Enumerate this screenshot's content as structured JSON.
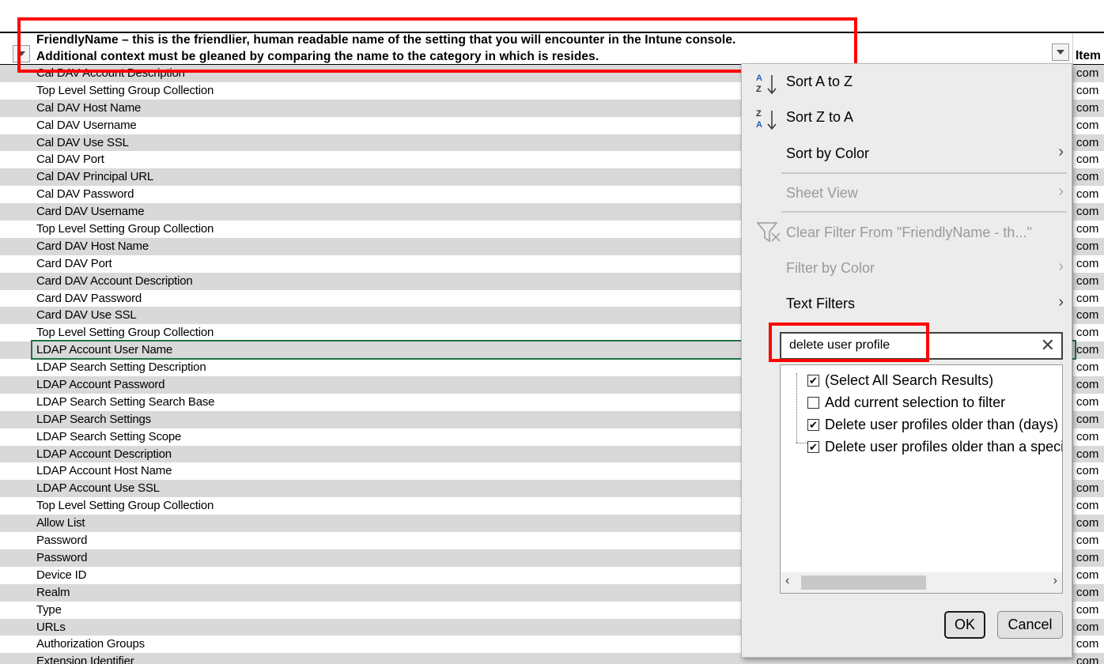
{
  "header": {
    "line1": "FriendlyName – this is the friendlier, human readable name of the setting that you will encounter in the Intune console.",
    "line2": "Additional context must be gleaned by comparing the name to the category in which is resides.",
    "item_col": "Item"
  },
  "rows": [
    "Cal DAV Account Description",
    "Top Level Setting Group Collection",
    "Cal DAV Host Name",
    "Cal DAV Username",
    "Cal DAV Use SSL",
    "Cal DAV Port",
    "Cal DAV Principal URL",
    "Cal DAV Password",
    "Card DAV Username",
    "Top Level Setting Group Collection",
    "Card DAV Host Name",
    "Card DAV Port",
    "Card DAV Account Description",
    "Card DAV Password",
    "Card DAV Use SSL",
    "Top Level Setting Group Collection",
    "LDAP Account User Name",
    "LDAP Search Setting Description",
    "LDAP Account Password",
    "LDAP Search Setting Search Base",
    "LDAP Search Settings",
    "LDAP Search Setting Scope",
    "LDAP Account Description",
    "LDAP Account Host Name",
    "LDAP Account Use SSL",
    "Top Level Setting Group Collection",
    "Allow List",
    "Password",
    "Password",
    "Device ID",
    "Realm",
    "Type",
    "URLs",
    "Authorization Groups",
    "Extension Identifier"
  ],
  "item_cell": "com",
  "menu": {
    "sort_az": "Sort A to Z",
    "sort_za": "Sort Z to A",
    "sort_color": "Sort by Color",
    "sheet_view": "Sheet View",
    "clear_filter": "Clear Filter From \"FriendlyName - th...\"",
    "filter_color": "Filter by Color",
    "text_filters": "Text Filters"
  },
  "search": {
    "value": "delete user profile",
    "clear": "✕"
  },
  "filter_list": [
    {
      "label": "(Select All Search Results)",
      "checked": true
    },
    {
      "label": "Add current selection to filter",
      "checked": false
    },
    {
      "label": "Delete user profiles older than (days)",
      "checked": true
    },
    {
      "label": "Delete user profiles older than a specified number of days",
      "checked": true
    }
  ],
  "buttons": {
    "ok": "OK",
    "cancel": "Cancel"
  },
  "colors": {
    "annotation": "#ff0000",
    "selection": "#217346",
    "row_alt": "#d9d9d9"
  }
}
